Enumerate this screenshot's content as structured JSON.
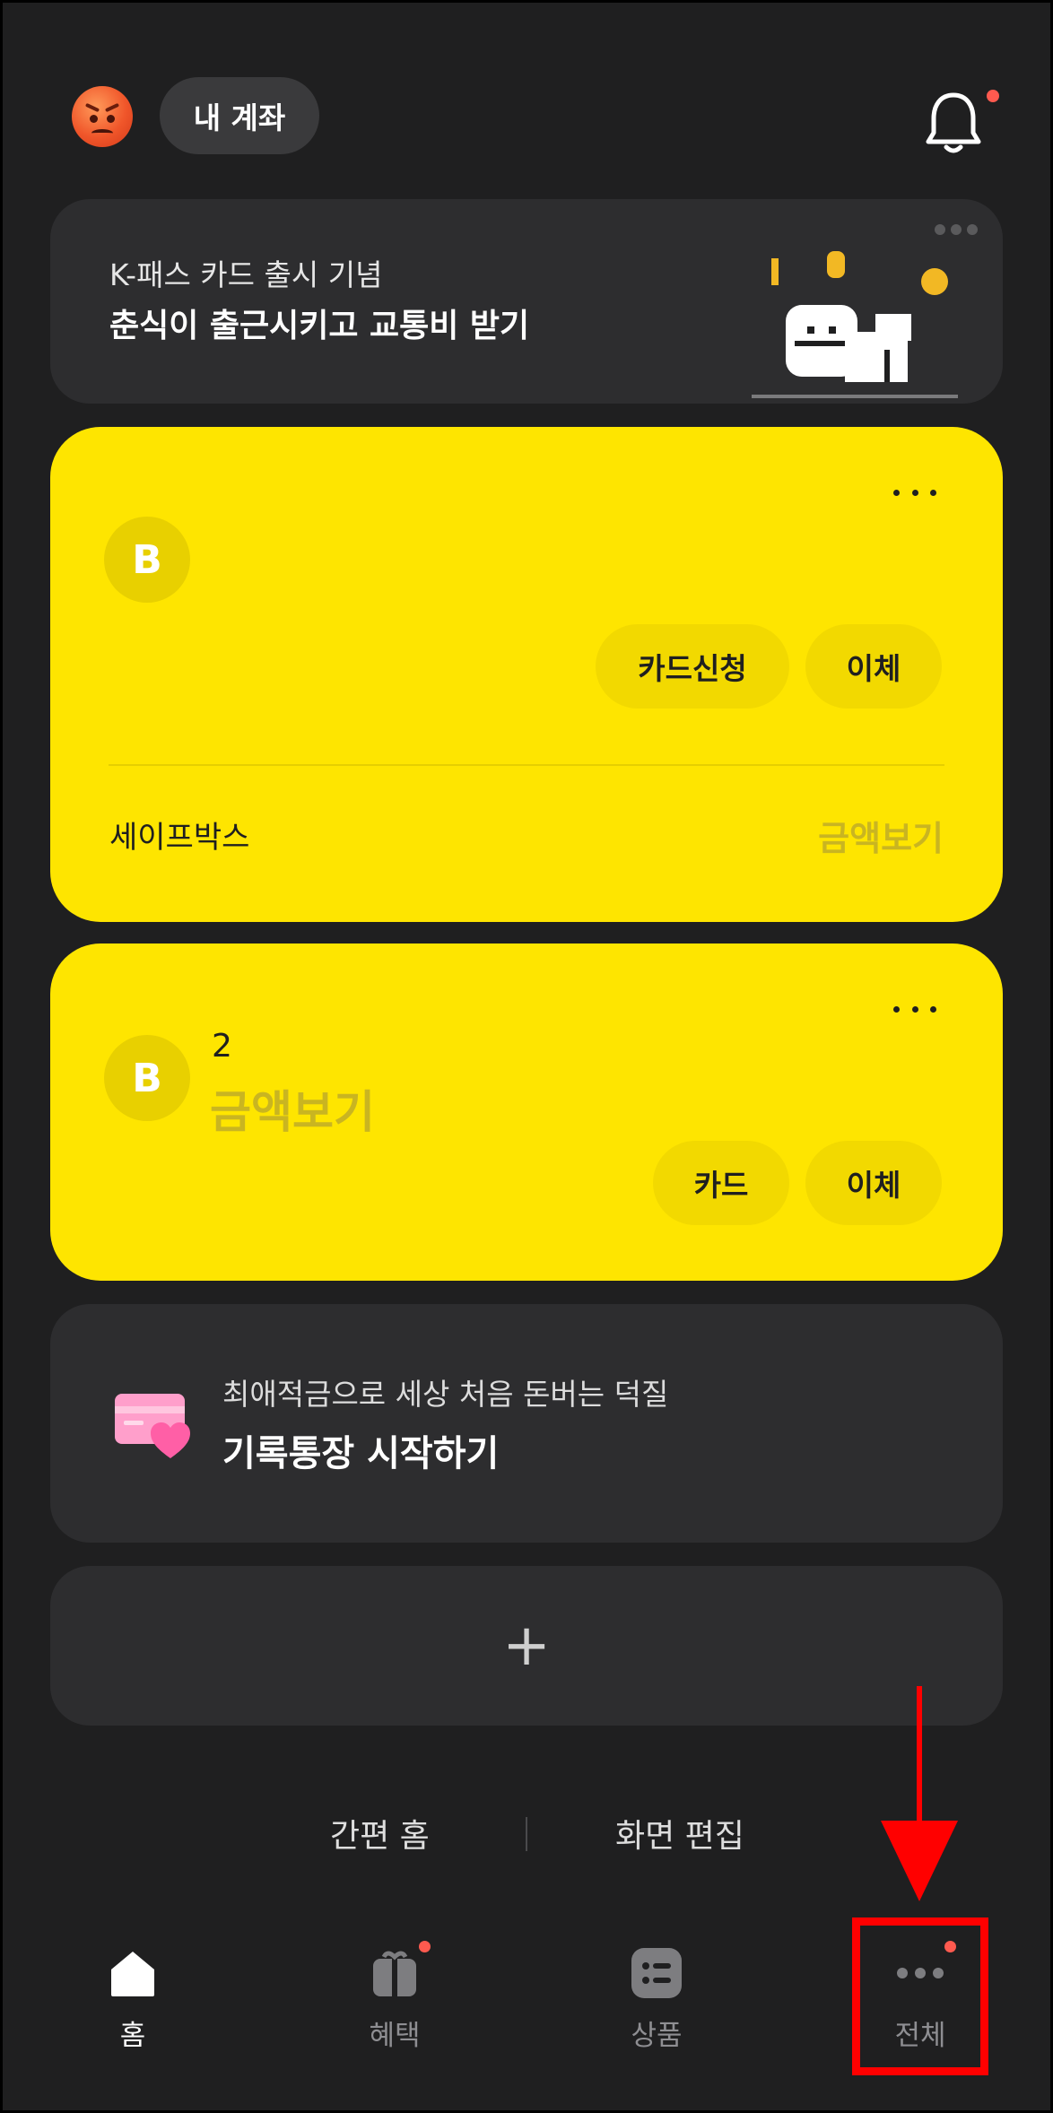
{
  "header": {
    "account_label": "내 계좌",
    "avatar_icon": "angry-face-emoji",
    "bell_icon": "bell-icon",
    "has_notification": true
  },
  "banner": {
    "subtitle": "K-패스 카드 출시 기념",
    "title": "춘식이 출근시키고 교통비 받기"
  },
  "account_card_1": {
    "bank_logo_letter": "B",
    "buttons": [
      "카드신청",
      "이체"
    ],
    "safebox_label": "세이프박스",
    "amount_link": "금액보기"
  },
  "account_card_2": {
    "bank_logo_letter": "B",
    "account_name": "2",
    "amount_link": "금액보기",
    "buttons": [
      "카드",
      "이체"
    ]
  },
  "savings_promo": {
    "subtitle": "최애적금으로 세상 처음 돈버는 덕질",
    "title": "기록통장 시작하기"
  },
  "add_card": {
    "symbol": "+"
  },
  "bottom_links": {
    "simple_home": "간편 홈",
    "edit_screen": "화면 편집"
  },
  "tabbar": {
    "tabs": [
      {
        "label": "홈",
        "icon": "home-icon",
        "active": true,
        "badge": false
      },
      {
        "label": "혜택",
        "icon": "gift-icon",
        "active": false,
        "badge": true
      },
      {
        "label": "상품",
        "icon": "list-icon",
        "active": false,
        "badge": false
      },
      {
        "label": "전체",
        "icon": "more-horizontal-icon",
        "active": false,
        "badge": true
      }
    ]
  },
  "colors": {
    "background": "#1f1f20",
    "card_dark": "#2d2d2f",
    "card_yellow": "#fee500",
    "badge_red": "#ff5a4f",
    "annotation_red": "#ff0000"
  }
}
